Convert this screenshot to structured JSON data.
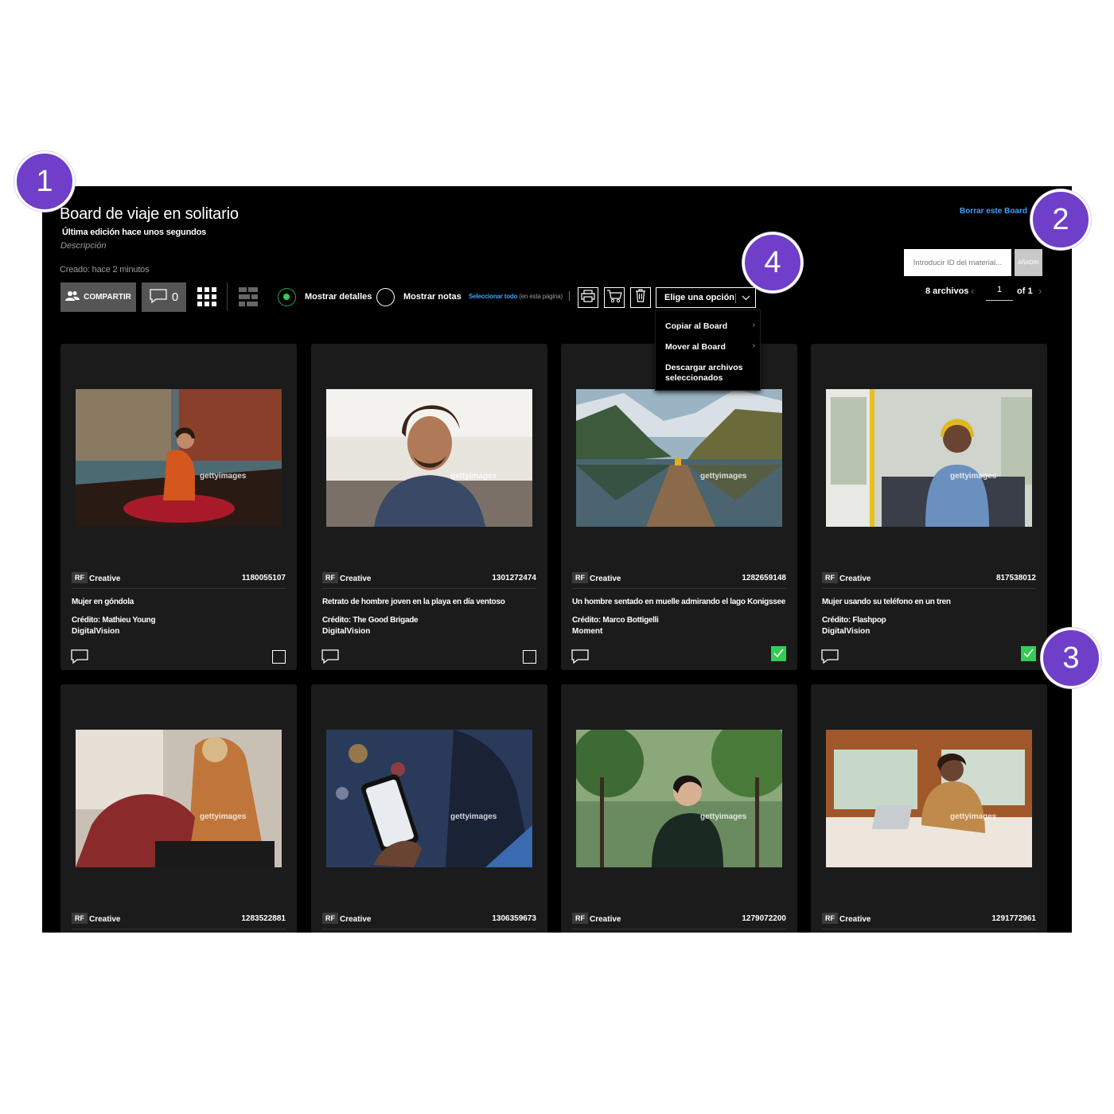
{
  "board": {
    "title": "Board de viaje en solitario",
    "last_edit": "Última edición hace unos segundos",
    "description_placeholder": "Descripción",
    "created": "Creado: hace 2 minutos",
    "delete_link": "Borrar este Board"
  },
  "toolbar": {
    "share_label": "COMPARTIR",
    "comment_count": "0",
    "show_details": "Mostrar detalles",
    "show_notes": "Mostrar notas",
    "select_all": "Seleccionar todo",
    "select_all_scope": "(en esta página)",
    "option_select": "Elige una opción",
    "dropdown_menu": [
      "Copiar al Board",
      "Mover al Board",
      "Descargar archivos seleccionados"
    ],
    "icons": [
      "share-users-icon",
      "comment-icon",
      "grid-view-icon",
      "mosaic-view-icon",
      "print-icon",
      "cart-icon",
      "trash-icon",
      "chevron-down-icon"
    ]
  },
  "asset_entry": {
    "placeholder": "Introducir ID del material...",
    "add_label": "AÑADIR"
  },
  "pagination": {
    "file_count": "8 archivos",
    "current_page": "1",
    "of_label": "of 1"
  },
  "watermark": "gettyimages",
  "cards": [
    {
      "rf": "RF",
      "category": "Creative",
      "id": "1180055107",
      "caption": "Mujer en góndola",
      "credit": "Crédito: Mathieu Young",
      "collection": "DigitalVision",
      "checked": false
    },
    {
      "rf": "RF",
      "category": "Creative",
      "id": "1301272474",
      "caption": "Retrato de hombre joven en la playa en día ventoso",
      "credit": "Crédito: The Good Brigade",
      "collection": "DigitalVision",
      "checked": false
    },
    {
      "rf": "RF",
      "category": "Creative",
      "id": "1282659148",
      "caption": "Un hombre sentado en muelle admirando el lago Konigssee",
      "credit": "Crédito: Marco Bottigelli",
      "collection": "Moment",
      "checked": true
    },
    {
      "rf": "RF",
      "category": "Creative",
      "id": "817538012",
      "caption": "Mujer usando su teléfono en un tren",
      "credit": "Crédito: Flashpop",
      "collection": "DigitalVision",
      "checked": true
    },
    {
      "rf": "RF",
      "category": "Creative",
      "id": "1283522881"
    },
    {
      "rf": "RF",
      "category": "Creative",
      "id": "1306359673"
    },
    {
      "rf": "RF",
      "category": "Creative",
      "id": "1279072200"
    },
    {
      "rf": "RF",
      "category": "Creative",
      "id": "1291772961"
    }
  ],
  "badges": [
    "1",
    "2",
    "3",
    "4"
  ],
  "colors": {
    "accent_link": "#3ea0ff",
    "checked_green": "#33cc55",
    "badge_purple": "#6f3fc9"
  }
}
